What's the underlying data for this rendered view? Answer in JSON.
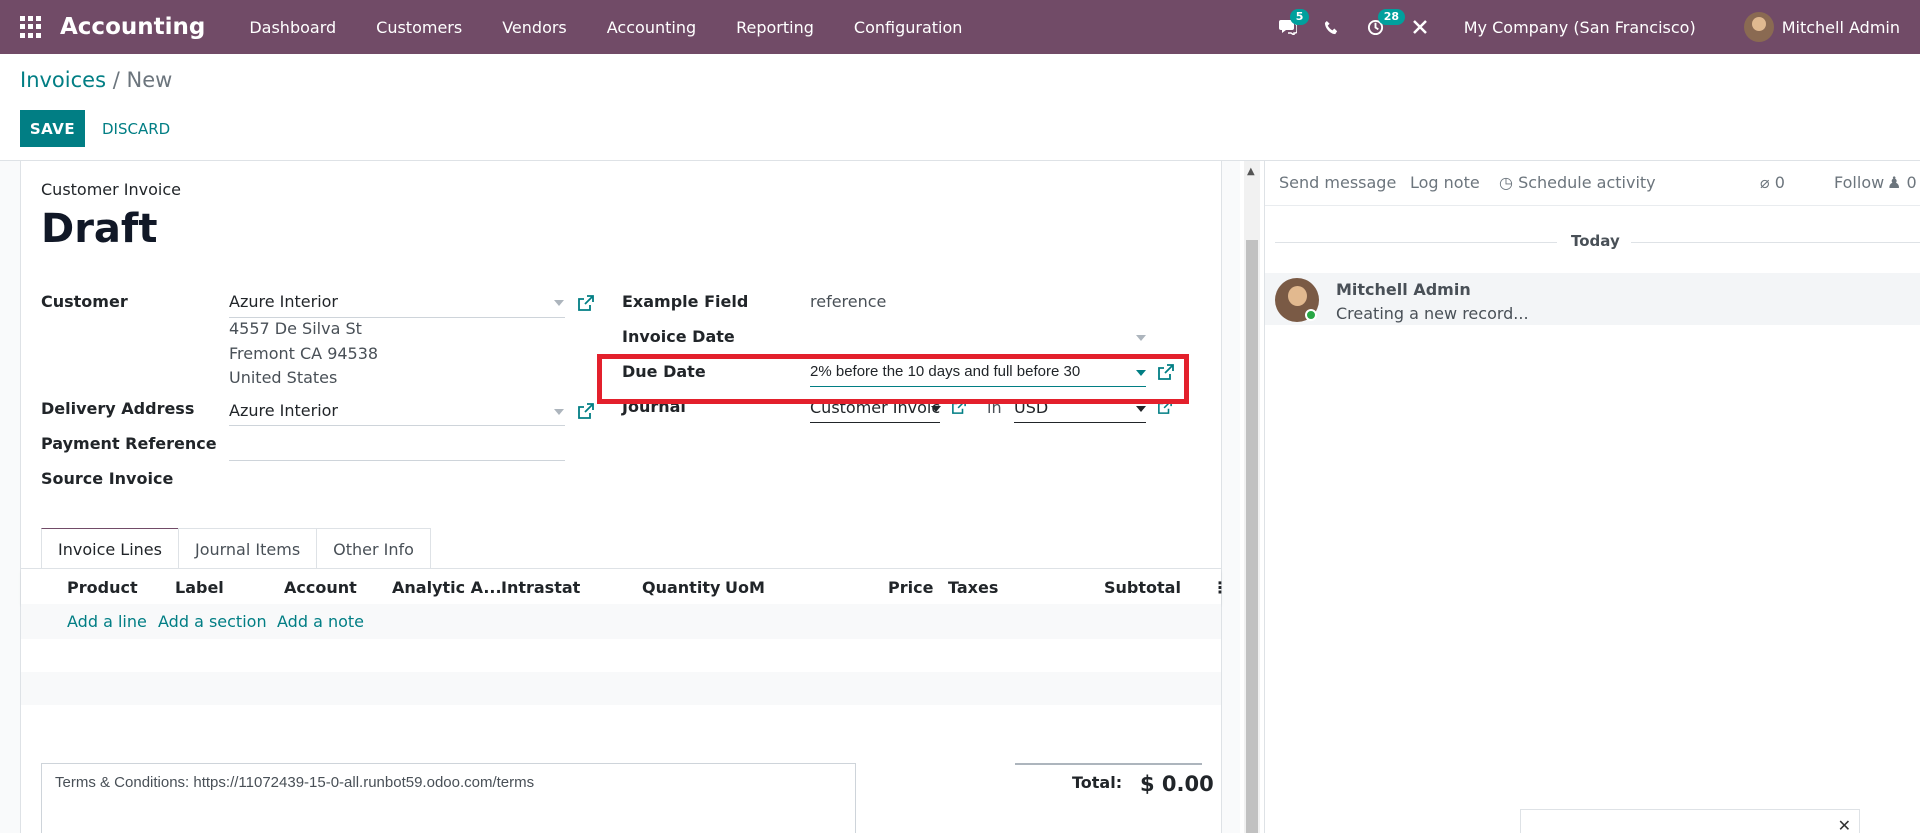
{
  "app": {
    "name": "Accounting",
    "menu": [
      "Dashboard",
      "Customers",
      "Vendors",
      "Accounting",
      "Reporting",
      "Configuration"
    ],
    "messages_badge": "5",
    "activities_badge": "28",
    "company": "My Company (San Francisco)",
    "user": "Mitchell Admin"
  },
  "breadcrumb": {
    "parent": "Invoices",
    "separator": "/",
    "current": "New"
  },
  "buttons": {
    "save": "SAVE",
    "discard": "DISCARD"
  },
  "form": {
    "type": "Customer Invoice",
    "state": "Draft",
    "customer_label": "Customer",
    "customer_value": "Azure Interior",
    "address": [
      "4557 De Silva St",
      "Fremont CA 94538",
      "United States"
    ],
    "delivery_label": "Delivery Address",
    "delivery_value": "Azure Interior",
    "payment_ref_label": "Payment Reference",
    "source_label": "Source Invoice",
    "example_label": "Example Field",
    "example_value": "reference",
    "invoice_date_label": "Invoice Date",
    "due_date_label": "Due Date",
    "due_date_value": "2% before the 10 days and full before 30",
    "journal_label": "Journal",
    "journal_value": "Customer Invoice",
    "in_label": "in",
    "currency_value": "USD"
  },
  "tabs": [
    "Invoice Lines",
    "Journal Items",
    "Other Info"
  ],
  "lines": {
    "columns": [
      "Product",
      "Label",
      "Account",
      "Analytic A...",
      "Intrastat",
      "Quantity",
      "UoM",
      "Price",
      "Taxes",
      "Subtotal"
    ],
    "add_line": "Add a line",
    "add_section": "Add a section",
    "add_note": "Add a note"
  },
  "terms": "Terms & Conditions: https://11072439-15-0-all.runbot59.odoo.com/terms",
  "total": {
    "label": "Total:",
    "value": "$ 0.00"
  },
  "chatter": {
    "send_message": "Send message",
    "log_note": "Log note",
    "schedule_activity": "Schedule activity",
    "attachments": "0",
    "follow": "Follow",
    "followers": "0",
    "today": "Today",
    "message_author": "Mitchell Admin",
    "message_body": "Creating a new record..."
  },
  "colors": {
    "brand": "#714b67",
    "accent": "#017e84",
    "highlight": "#e3202c"
  }
}
